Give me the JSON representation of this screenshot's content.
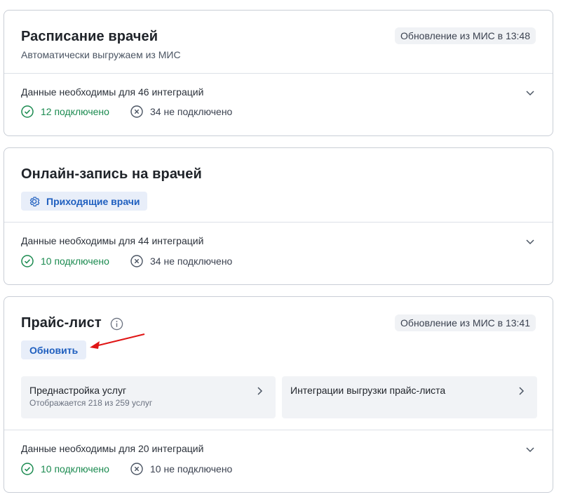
{
  "schedule_card": {
    "title": "Расписание врачей",
    "subtitle": "Автоматически выгружаем из МИС",
    "update_badge": "Обновление из МИС в 13:48",
    "integrations_title": "Данные необходимы для 46 интеграций",
    "connected": "12 подключено",
    "not_connected": "34 не подключено"
  },
  "online_card": {
    "title": "Онлайн-запись на врачей",
    "button_label": "Приходящие врачи",
    "integrations_title": "Данные необходимы для 44 интеграций",
    "connected": "10 подключено",
    "not_connected": "34 не подключено"
  },
  "price_card": {
    "title": "Прайс-лист",
    "update_badge": "Обновление из МИС в 13:41",
    "update_button": "Обновить",
    "tile_services_title": "Преднастройка услуг",
    "tile_services_sub": "Отображается 218 из 259 услуг",
    "tile_integrations_title": "Интеграции выгрузки прайс-листа",
    "integrations_title": "Данные необходимы для 20 интеграций",
    "connected": "10 подключено",
    "not_connected": "10 не подключено"
  },
  "colors": {
    "success": "#1a8a4f",
    "accent": "#1f5fbf",
    "arrow": "#e01515"
  },
  "icons": [
    "check-circle-icon",
    "x-circle-icon",
    "chevron-down-icon",
    "chevron-right-icon",
    "gear-icon",
    "info-icon",
    "arrow-annotation"
  ]
}
